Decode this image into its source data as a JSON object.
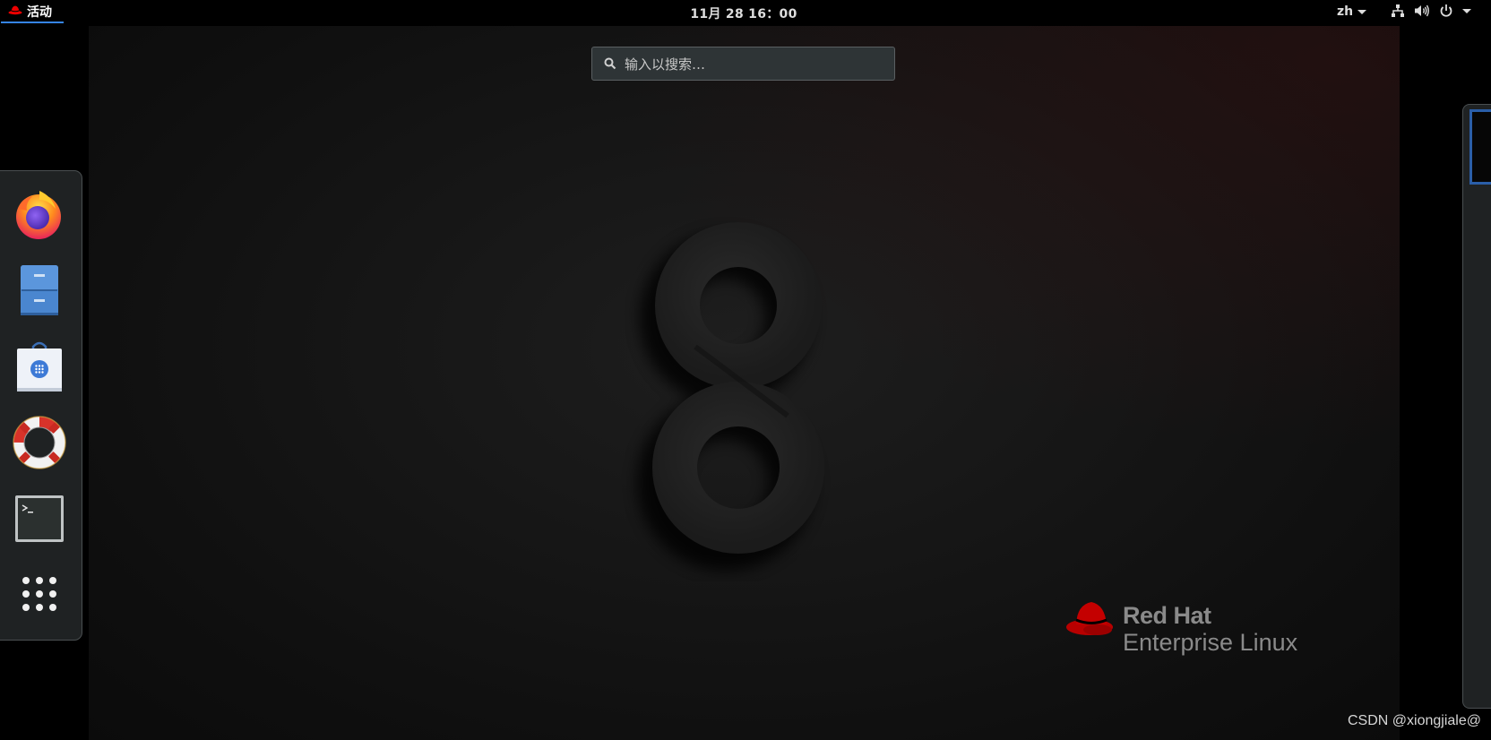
{
  "topbar": {
    "activities_label": "活动",
    "clock": "11月 28  16：00",
    "language": "zh",
    "icons": [
      "redhat-icon",
      "network-icon",
      "volume-icon",
      "power-icon",
      "chevron-down-icon"
    ]
  },
  "search": {
    "placeholder": "输入以搜索…"
  },
  "dash": {
    "items": [
      {
        "name": "Firefox",
        "icon": "firefox-icon"
      },
      {
        "name": "Files",
        "icon": "file-cabinet-icon"
      },
      {
        "name": "Software",
        "icon": "software-bag-icon"
      },
      {
        "name": "Help",
        "icon": "lifebuoy-icon"
      },
      {
        "name": "Terminal",
        "icon": "terminal-icon"
      },
      {
        "name": "Show Applications",
        "icon": "app-grid-icon"
      }
    ]
  },
  "wallpaper": {
    "numeral": "8",
    "brand_line1": "Red Hat",
    "brand_line2": "Enterprise Linux"
  },
  "watermark": "CSDN @xiongjiale@",
  "colors": {
    "accent": "#3584e4",
    "panel": "#1f2223",
    "redhat": "#ee0000",
    "workspace_border": "#2a5ea8"
  }
}
